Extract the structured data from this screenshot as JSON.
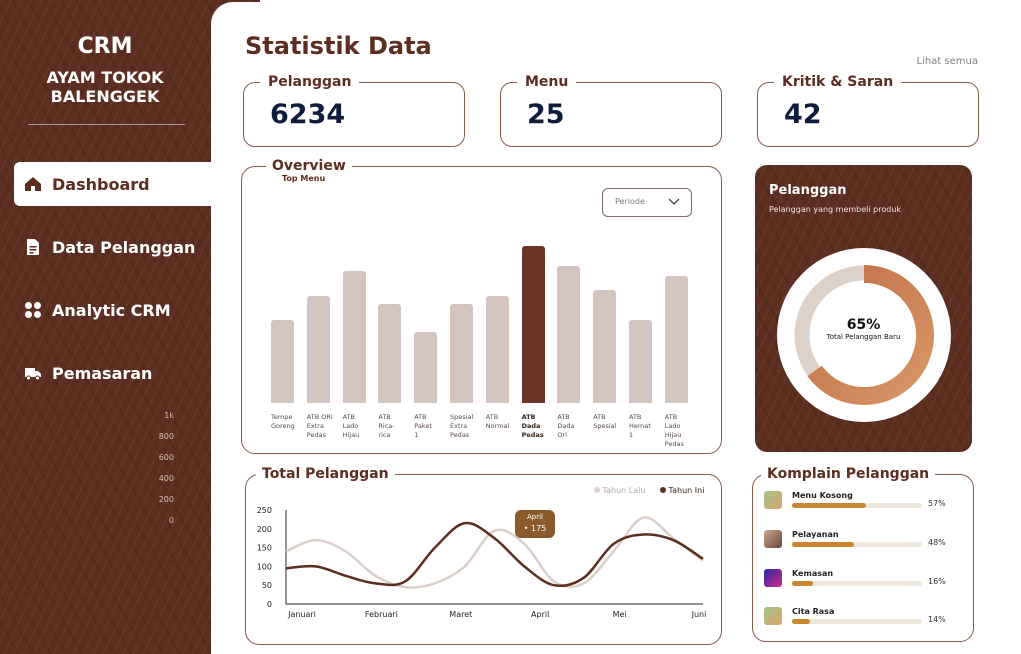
{
  "sidebar": {
    "brand_title": "CRM",
    "brand_line1": "AYAM TOKOK",
    "brand_line2": "BALENGGEK",
    "items": [
      {
        "label": "Dashboard",
        "icon": "home-icon"
      },
      {
        "label": "Data Pelanggan",
        "icon": "document-icon"
      },
      {
        "label": "Analytic CRM",
        "icon": "grid-icon"
      },
      {
        "label": "Pemasaran",
        "icon": "truck-icon"
      }
    ],
    "faint_ticks": [
      "1k",
      "800",
      "600",
      "400",
      "200",
      "0"
    ]
  },
  "header": {
    "title": "Statistik Data",
    "see_all": "Lihat semua"
  },
  "stats": [
    {
      "label": "Pelanggan",
      "value": "6234"
    },
    {
      "label": "Menu",
      "value": "25"
    },
    {
      "label": "Kritik & Saran",
      "value": "42"
    }
  ],
  "overview": {
    "title": "Overview",
    "subtitle": "Top Menu",
    "select_value": "Periode"
  },
  "donut": {
    "title": "Pelanggan",
    "subtitle": "Pelanggan yang membeli produk",
    "percent_label": "65%",
    "caption": "Total Pelanggan Baru",
    "percent": 65,
    "colors": {
      "track": "#ffffff",
      "inner_track": "#dcd2ca",
      "arc_start": "#c06d44",
      "arc_end": "#d99a6a"
    }
  },
  "line": {
    "title": "Total Pelanggan",
    "legend_last": "Tahun Lalu",
    "legend_this": "Tahun Ini",
    "tooltip_month": "April",
    "tooltip_value": "175",
    "colors": {
      "last": "#dccfca",
      "this": "#5b2e1f",
      "tooltip": "#8a5a2b"
    }
  },
  "complaints": {
    "title": "Komplain Pelanggan",
    "items": [
      {
        "label": "Menu Kosong",
        "percent_label": "57%",
        "percent": 57
      },
      {
        "label": "Pelayanan",
        "percent_label": "48%",
        "percent": 48
      },
      {
        "label": "Kemasan",
        "percent_label": "16%",
        "percent": 16
      },
      {
        "label": "Cita Rasa",
        "percent_label": "14%",
        "percent": 14
      }
    ]
  },
  "chart_data": [
    {
      "type": "bar",
      "title": "Overview",
      "subtitle": "Top Menu",
      "categories": [
        [
          "Tempe",
          "Goreng"
        ],
        [
          "ATB ORI",
          "Extra",
          "Pedas"
        ],
        [
          "ATB Lado",
          "Hijau"
        ],
        [
          "ATB",
          "Rica-",
          "rica"
        ],
        [
          "ATB",
          "Paket",
          "1"
        ],
        [
          "Spesial",
          "Extra",
          "Pedas"
        ],
        [
          "ATB",
          "Normal"
        ],
        [
          "ATB",
          "Dada",
          "Pedas"
        ],
        [
          "ATB",
          "Dada",
          "Ori"
        ],
        [
          "ATB",
          "Spesial"
        ],
        [
          "ATB",
          "Hemat",
          "1"
        ],
        [
          "ATB Lado",
          "Hijau",
          "Pedas"
        ]
      ],
      "values": [
        0.53,
        0.68,
        0.84,
        0.63,
        0.45,
        0.63,
        0.68,
        1.0,
        0.87,
        0.72,
        0.53,
        0.81
      ],
      "highlight_index": 7,
      "colors": {
        "bar": "#d3c4bf",
        "highlight": "#6a3526"
      }
    },
    {
      "type": "line",
      "title": "Total Pelanggan",
      "x": [
        "Januari",
        "Februari",
        "Maret",
        "April",
        "Mei",
        "Juni"
      ],
      "yticks": [
        0,
        50,
        100,
        150,
        200,
        250
      ],
      "ylim": [
        0,
        250
      ],
      "series": [
        {
          "name": "Tahun Lalu",
          "values": [
            140,
            170,
            140,
            75,
            45,
            55,
            100,
            195,
            160,
            60,
            55,
            140,
            230,
            175,
            115
          ]
        },
        {
          "name": "Tahun Ini",
          "values": [
            95,
            100,
            75,
            55,
            60,
            150,
            215,
            175,
            100,
            50,
            70,
            160,
            185,
            170,
            120
          ]
        }
      ],
      "x_positions": [
        0,
        0.5,
        1,
        1.5,
        2,
        2.5,
        3,
        3.5,
        4,
        4.5,
        5,
        5.5,
        6,
        6.5,
        7
      ],
      "tooltip": {
        "x_index": 7,
        "label": "April",
        "value": 175
      }
    }
  ]
}
